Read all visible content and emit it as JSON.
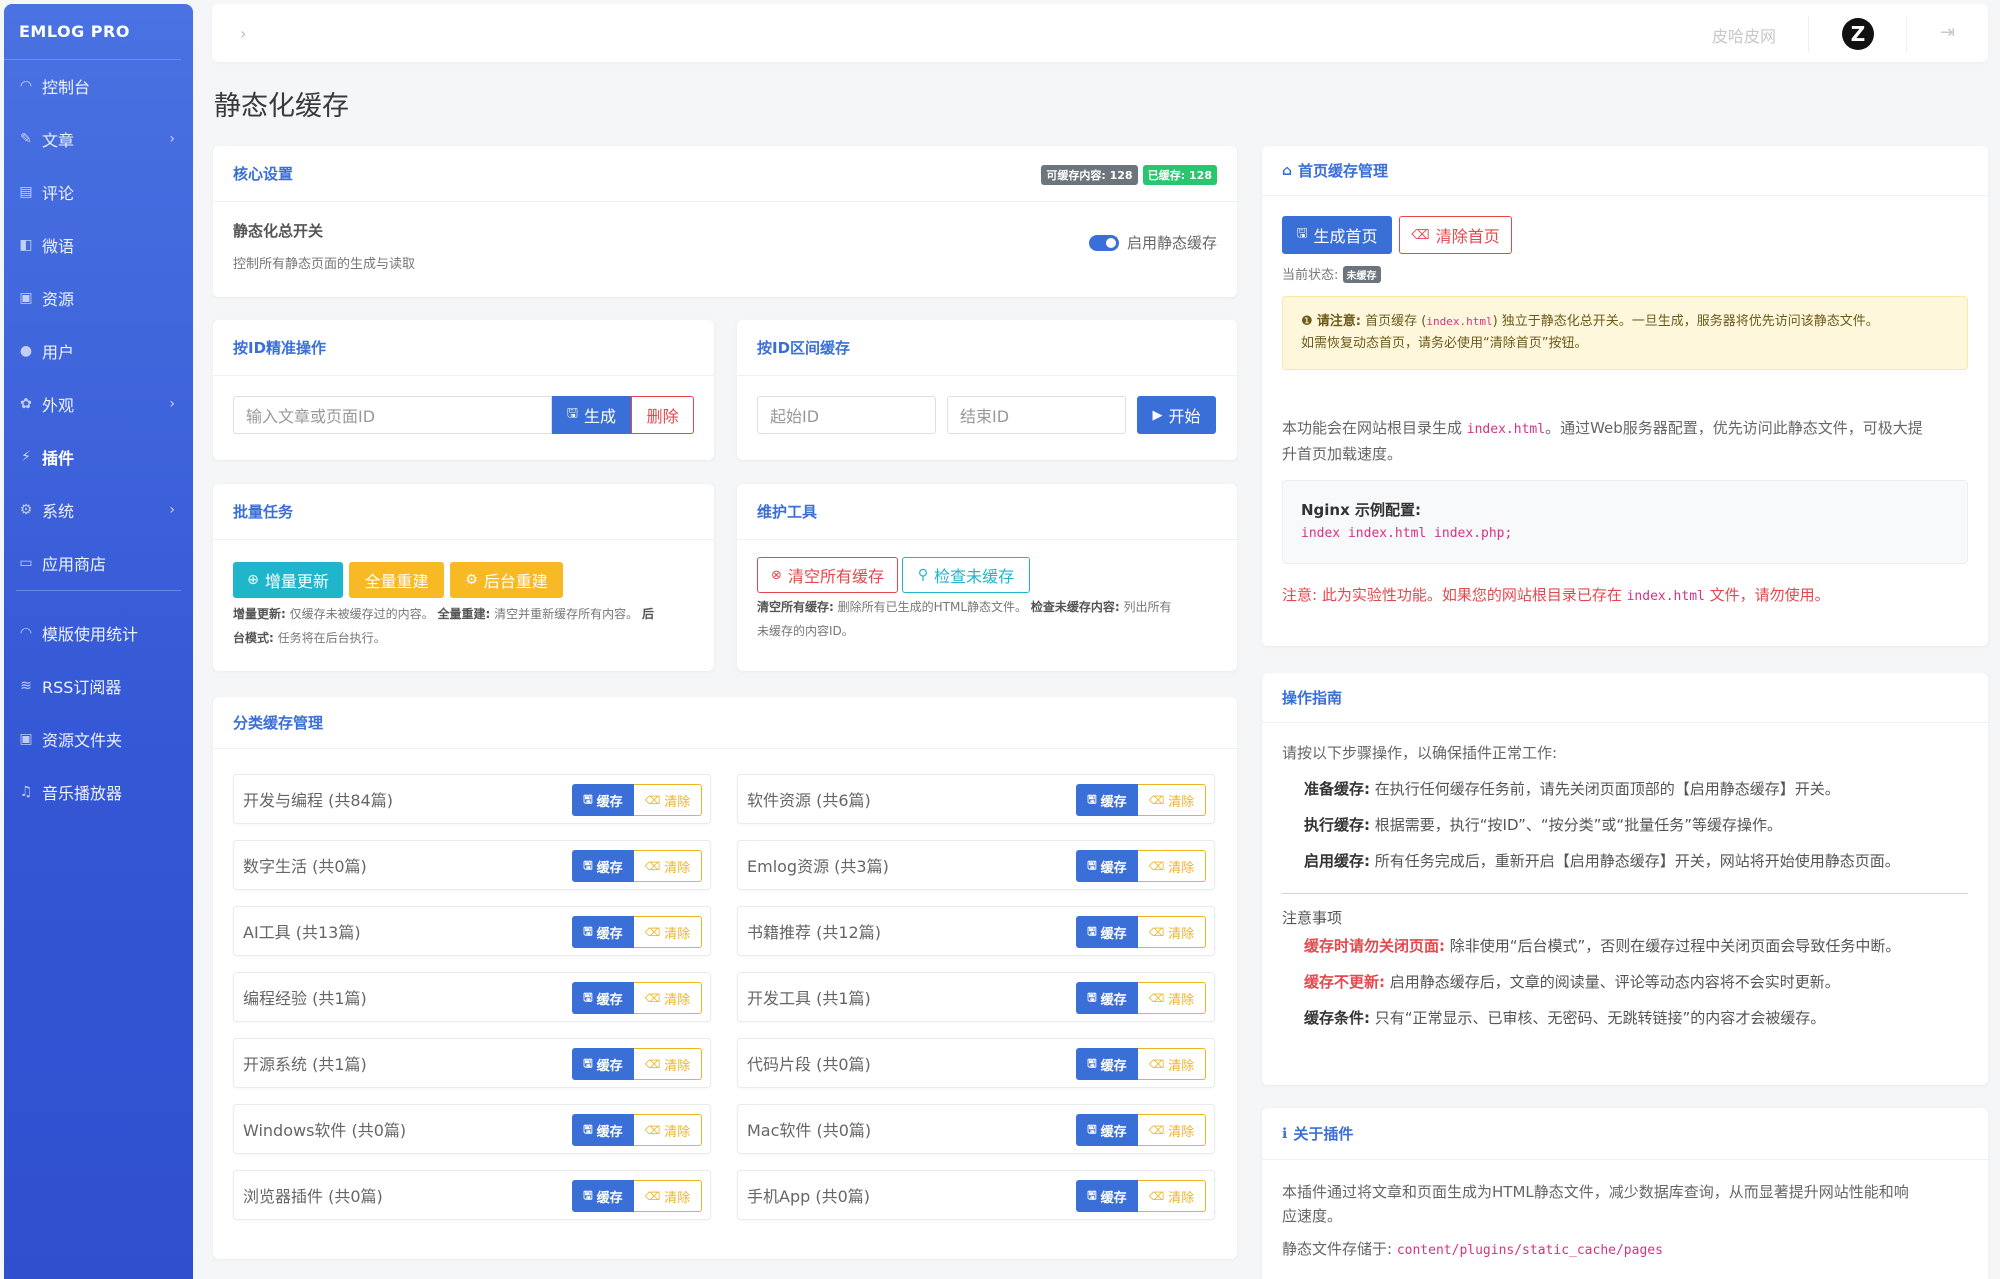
{
  "sidebar": {
    "brand": "EMLOG PRO",
    "items": [
      {
        "label": "控制台",
        "icon": "◠",
        "chev": ""
      },
      {
        "label": "文章",
        "icon": "✎",
        "chev": "›"
      },
      {
        "label": "评论",
        "icon": "▤",
        "chev": ""
      },
      {
        "label": "微语",
        "icon": "◧",
        "chev": ""
      },
      {
        "label": "资源",
        "icon": "▣",
        "chev": ""
      },
      {
        "label": "用户",
        "icon": "●",
        "chev": ""
      },
      {
        "label": "外观",
        "icon": "✿",
        "chev": "›"
      },
      {
        "label": "插件",
        "icon": "⚡",
        "chev": ""
      },
      {
        "label": "系统",
        "icon": "⚙",
        "chev": "›"
      },
      {
        "label": "应用商店",
        "icon": "▭",
        "chev": ""
      },
      {
        "label": "模版使用统计",
        "icon": "◠",
        "chev": ""
      },
      {
        "label": "RSS订阅器",
        "icon": "≋",
        "chev": ""
      },
      {
        "label": "资源文件夹",
        "icon": "▣",
        "chev": ""
      },
      {
        "label": "音乐播放器",
        "icon": "♫",
        "chev": ""
      }
    ]
  },
  "topbar": {
    "toggle": "›",
    "user": "皮哈皮网",
    "avatar": "Z",
    "logout": "⇥"
  },
  "page_title": "静态化缓存",
  "core": {
    "title": "核心设置",
    "badge_total": "可缓存内容: 128",
    "badge_cached": "已缓存: 128",
    "switch_title": "静态化总开关",
    "switch_desc": "控制所有静态页面的生成与读取",
    "switch_label": "启用静态缓存"
  },
  "byid": {
    "title": "按ID精准操作",
    "placeholder": "输入文章或页面ID",
    "generate": "生成",
    "delete": "删除"
  },
  "range": {
    "title": "按ID区间缓存",
    "start_placeholder": "起始ID",
    "end_placeholder": "结束ID",
    "start_btn": "开始"
  },
  "batch": {
    "title": "批量任务",
    "incremental": "增量更新",
    "full": "全量重建",
    "background": "后台重建",
    "note_k1": "增量更新:",
    "note_v1": " 仅缓存未被缓存过的内容。",
    "note_k2": "全量重建:",
    "note_v2": " 清空并重新缓存所有内容。",
    "note_k3": "后台模式:",
    "note_v3": " 任务将在后台执行。",
    "note_k3a": "后",
    "note_k3b": "台模式:"
  },
  "maint": {
    "title": "维护工具",
    "clear_all": "清空所有缓存",
    "check": "检查未缓存",
    "note_k1": "清空所有缓存:",
    "note_v1": " 删除所有已生成的HTML静态文件。",
    "note_k2": "检查未缓存内容:",
    "note_v2": " 列出所有",
    "note_v2b": "未缓存的内容ID。"
  },
  "category": {
    "title": "分类缓存管理",
    "cache_label": "缓存",
    "clear_label": "清除",
    "items": [
      "开发与编程 (共84篇)",
      "软件资源 (共6篇)",
      "数字生活 (共0篇)",
      "Emlog资源 (共3篇)",
      "AI工具 (共13篇)",
      "书籍推荐 (共12篇)",
      "编程经验 (共1篇)",
      "开发工具 (共1篇)",
      "开源系统 (共1篇)",
      "代码片段 (共0篇)",
      "Windows软件 (共0篇)",
      "Mac软件 (共0篇)",
      "浏览器插件 (共0篇)",
      "手机App (共0篇)"
    ]
  },
  "home": {
    "title": "首页缓存管理",
    "generate": "生成首页",
    "clear": "清除首页",
    "status_label": "当前状态:",
    "status_badge": "未缓存",
    "warn_strong": "请注意:",
    "warn_1": " 首页缓存 (",
    "warn_code": "index.html",
    "warn_2": ") 独立于静态化总开关。一旦生成，服务器将优先访问该静态文件。",
    "warn_3": "如需恢复动态首页，请务必使用“清除首页”按钮。",
    "desc_1": "本功能会在网站根目录生成 ",
    "desc_code": "index.html",
    "desc_2": "。通过Web服务器配置，优先访问此静态文件，可极大提",
    "desc_3": "升首页加载速度。",
    "nginx_title": "Nginx 示例配置:",
    "nginx_code": "index index.html index.php;",
    "notice_1": "注意: 此为实验性功能。如果您的网站根目录已存在 ",
    "notice_code": "index.html",
    "notice_2": " 文件，请勿使用。"
  },
  "guide": {
    "title": "操作指南",
    "intro": "请按以下步骤操作，以确保插件正常工作:",
    "steps": [
      {
        "k": "准备缓存:",
        "v": " 在执行任何缓存任务前，请先关闭页面顶部的【启用静态缓存】开关。"
      },
      {
        "k": "执行缓存:",
        "v": " 根据需要，执行“按ID”、“按分类”或“批量任务”等缓存操作。"
      },
      {
        "k": "启用缓存:",
        "v": " 所有任务完成后，重新开启【启用静态缓存】开关，网站将开始使用静态页面。"
      }
    ],
    "notes_title": "注意事项",
    "notes": [
      {
        "k": "缓存时请勿关闭页面:",
        "v": " 除非使用“后台模式”，否则在缓存过程中关闭页面会导致任务中断。",
        "red": true
      },
      {
        "k": "缓存不更新:",
        "v": " 启用静态缓存后，文章的阅读量、评论等动态内容将不会实时更新。",
        "red": true
      },
      {
        "k": "缓存条件:",
        "v": " 只有“正常显示、已审核、无密码、无跳转链接”的内容才会被缓存。",
        "red": false
      }
    ]
  },
  "about": {
    "title": "关于插件",
    "desc_1": "本插件通过将文章和页面生成为HTML静态文件，减少数据库查询，从而显著提升网站性能和响",
    "desc_2": "应速度。",
    "path_label": "静态文件存储于: ",
    "path_code": "content/plugins/static_cache/pages"
  }
}
